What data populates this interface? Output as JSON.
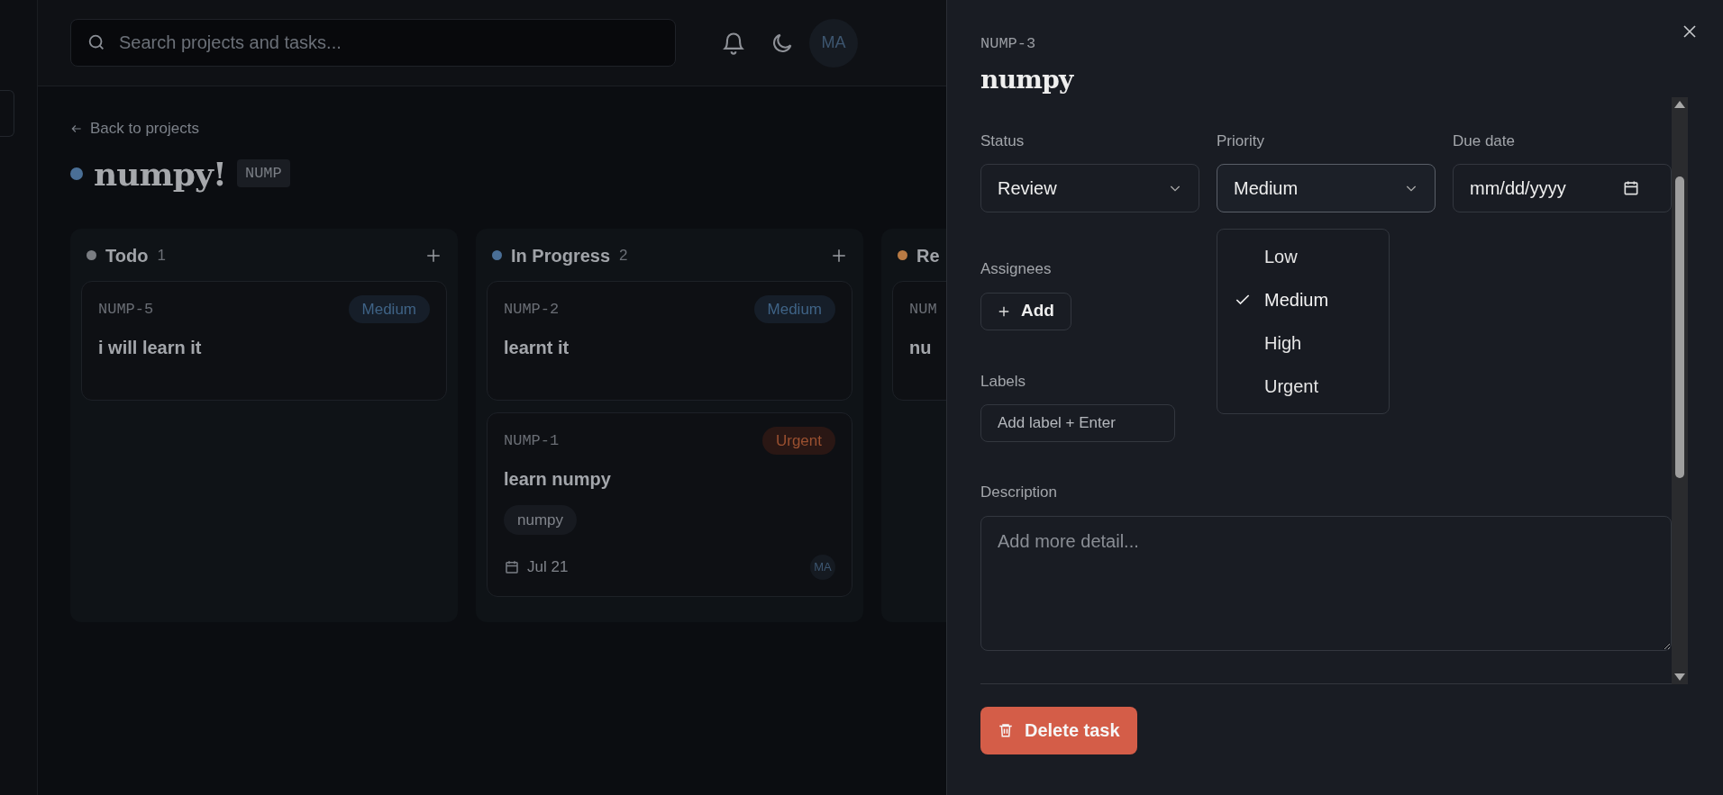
{
  "search": {
    "placeholder": "Search projects and tasks..."
  },
  "user": {
    "initials": "MA"
  },
  "back_link": "Back to projects",
  "project": {
    "name": "numpy!",
    "key": "NUMP",
    "color": "#4a6f96"
  },
  "columns": [
    {
      "name": "Todo",
      "count": "1",
      "color": "#7a7d82",
      "cards": [
        {
          "id": "NUMP-5",
          "title": "i will learn it",
          "priority": {
            "label": "Medium",
            "kind": "medium"
          }
        }
      ]
    },
    {
      "name": "In Progress",
      "count": "2",
      "color": "#4a6f96",
      "cards": [
        {
          "id": "NUMP-2",
          "title": "learnt it",
          "priority": {
            "label": "Medium",
            "kind": "medium"
          }
        },
        {
          "id": "NUMP-1",
          "title": "learn numpy",
          "priority": {
            "label": "Urgent",
            "kind": "urgent"
          },
          "labels": [
            "numpy"
          ],
          "due": "Jul 21",
          "assignee": "MA"
        }
      ]
    },
    {
      "name": "Re",
      "color": "#b87a44",
      "cards": [
        {
          "id": "NUM",
          "title": "nu"
        }
      ]
    }
  ],
  "task": {
    "id": "NUMP-3",
    "title": "numpy",
    "status": {
      "label": "Status",
      "value": "Review"
    },
    "priority": {
      "label": "Priority",
      "value": "Medium",
      "expanded": true,
      "options": [
        {
          "label": "Low",
          "selected": false
        },
        {
          "label": "Medium",
          "selected": true
        },
        {
          "label": "High",
          "selected": false
        },
        {
          "label": "Urgent",
          "selected": false
        }
      ]
    },
    "due_date": {
      "label": "Due date",
      "placeholder": "mm/dd/yyyy"
    },
    "assignees": {
      "label": "Assignees",
      "button": "Add"
    },
    "labels": {
      "label": "Labels",
      "placeholder": "Add label + Enter"
    },
    "description": {
      "label": "Description",
      "placeholder": "Add more detail..."
    },
    "delete_button": "Delete task"
  }
}
